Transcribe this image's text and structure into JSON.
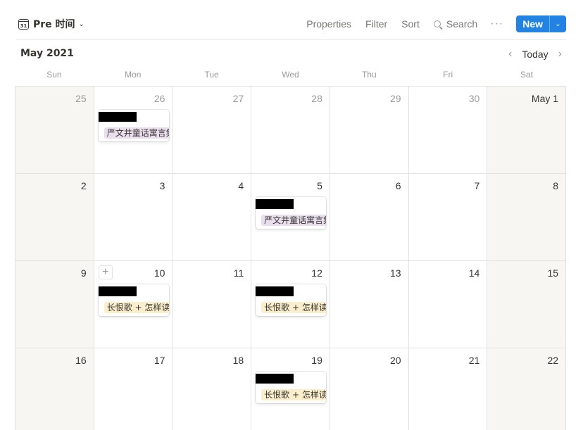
{
  "toolbar": {
    "view_name": "Pre 时间",
    "calendar_icon_text": "31",
    "properties": "Properties",
    "filter": "Filter",
    "sort": "Sort",
    "search": "Search",
    "more": "···",
    "new": "New"
  },
  "header": {
    "month": "May 2021",
    "today": "Today"
  },
  "weekdays": [
    "Sun",
    "Mon",
    "Tue",
    "Wed",
    "Thu",
    "Fri",
    "Sat"
  ],
  "weeks": [
    [
      "25",
      "26",
      "27",
      "28",
      "29",
      "30",
      "May 1"
    ],
    [
      "2",
      "3",
      "4",
      "5",
      "6",
      "7",
      "8"
    ],
    [
      "9",
      "10",
      "11",
      "12",
      "13",
      "14",
      "15"
    ],
    [
      "16",
      "17",
      "18",
      "19",
      "20",
      "21",
      "22"
    ]
  ],
  "events": [
    {
      "week": 0,
      "day": 1,
      "tag": "严文井童话寓言集",
      "tag_color": "purple",
      "title_redacted": true
    },
    {
      "week": 1,
      "day": 3,
      "tag": "严文井童话寓言集",
      "tag_color": "purple",
      "title_redacted": true
    },
    {
      "week": 2,
      "day": 1,
      "tag": "长恨歌 + 怎样读书",
      "tag_color": "yellow",
      "title_redacted": true
    },
    {
      "week": 2,
      "day": 3,
      "tag": "长恨歌 + 怎样读书",
      "tag_color": "yellow",
      "title_redacted": true
    },
    {
      "week": 3,
      "day": 3,
      "tag": "长恨歌 + 怎样读书",
      "tag_color": "yellow",
      "title_redacted": true
    }
  ],
  "colors": {
    "accent": "#2383e2",
    "tag_purple": "#e8deee",
    "tag_yellow": "#fbeecc",
    "weekend_bg": "#f7f6f3"
  }
}
